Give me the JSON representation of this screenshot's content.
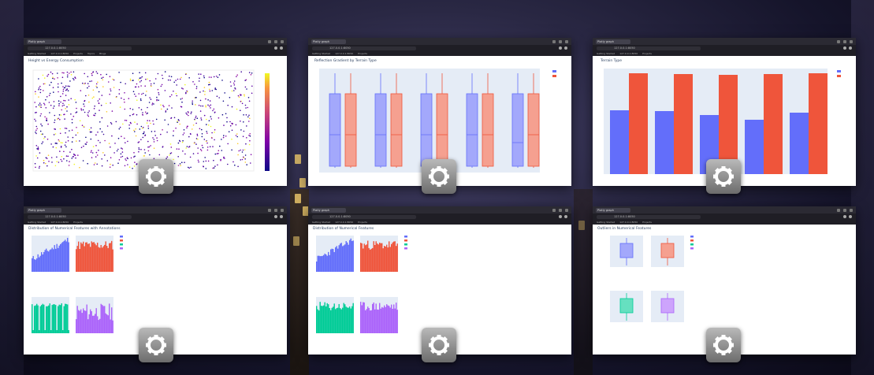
{
  "windows": [
    {
      "tab_label": "Plotly graph",
      "url": "127.0.0.1:8050",
      "chart_title": "Height vs Energy Consumption"
    },
    {
      "tab_label": "Plotly graph",
      "url": "127.0.0.1:8050",
      "chart_title": "Reflection Gradient by Terrain Type"
    },
    {
      "tab_label": "Plotly graph",
      "url": "127.0.0.1:8050",
      "chart_title": "Terrain Type"
    },
    {
      "tab_label": "Plotly graph",
      "url": "127.0.0.1:8050",
      "chart_title": "Distribution of Numerical Features with Annotations",
      "subplots": [
        "Height",
        "Energy",
        "Reflection",
        "Rain"
      ]
    },
    {
      "tab_label": "Plotly graph",
      "url": "127.0.0.1:8050",
      "chart_title": "Distribution of Numerical Features",
      "subplots": [
        "Height",
        "Energy",
        "Reflection",
        "Rain"
      ]
    },
    {
      "tab_label": "Plotly graph",
      "url": "127.0.0.1:8050",
      "chart_title": "Outliers in Numerical Features",
      "subplots": [
        "Height",
        "Energy",
        "Reflection",
        "Rain"
      ]
    }
  ],
  "bookmarks": [
    "Getting Started",
    "127.0.0.1:8050",
    "Projects",
    "Topics",
    "Blogs"
  ],
  "colors": {
    "blue": "#636efa",
    "red": "#ef553b",
    "green": "#00cc96",
    "purple": "#ab63fa",
    "plot_bg": "#e5ecf6"
  },
  "icons": {
    "overlay": "gear-icon"
  }
}
